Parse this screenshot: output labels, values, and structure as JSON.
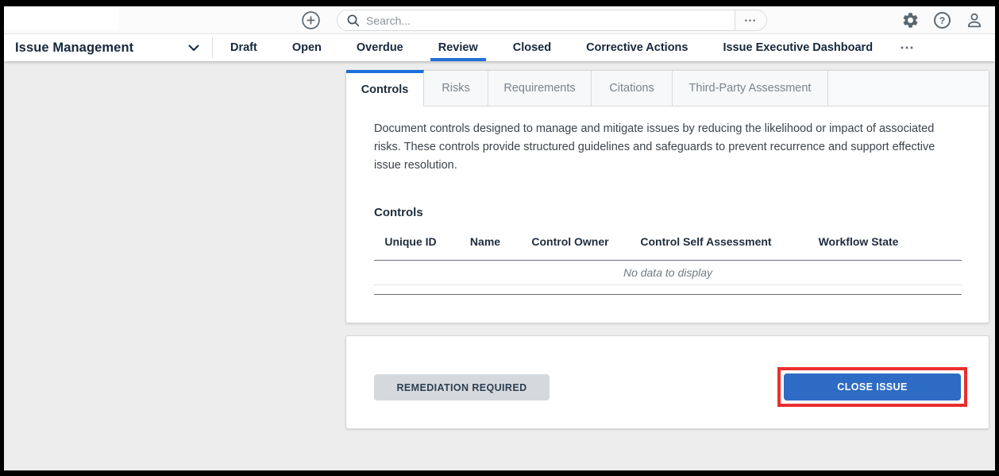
{
  "topbar": {
    "search": {
      "placeholder": "Search...",
      "value": "",
      "more_glyph": "•••"
    },
    "icons": {
      "plus_circle": "add",
      "magnifier": "search",
      "gear": "settings",
      "help_glyph": "?",
      "person": "profile"
    }
  },
  "navbar": {
    "title": "Issue Management",
    "links": [
      "Draft",
      "Open",
      "Overdue",
      "Review",
      "Closed",
      "Corrective Actions",
      "Issue Executive Dashboard"
    ],
    "active_link": "Review",
    "overflow_glyph": "⋯"
  },
  "tabs": {
    "items": [
      "Controls",
      "Risks",
      "Requirements",
      "Citations",
      "Third-Party Assessment"
    ],
    "active": "Controls"
  },
  "panel": {
    "description": "Document controls designed to manage and mitigate issues by reducing the likelihood or impact of associated risks. These controls provide structured guidelines and safeguards to prevent recurrence and support effective issue resolution.",
    "section_title": "Controls",
    "table": {
      "columns": [
        "Unique ID",
        "Name",
        "Control Owner",
        "Control Self Assessment",
        "Workflow State"
      ],
      "rows": [],
      "empty_message": "No data to display"
    }
  },
  "actions": {
    "remediation_label": "REMEDIATION REQUIRED",
    "close_label": "CLOSE ISSUE",
    "close_highlighted": true
  },
  "colors": {
    "accent_blue": "#2270d3",
    "tab_blue": "#1d6fd8",
    "button_blue": "#2e6bc4",
    "highlight_red": "#e9302e",
    "navy_text": "#16283e",
    "content_background": "#ededee"
  }
}
